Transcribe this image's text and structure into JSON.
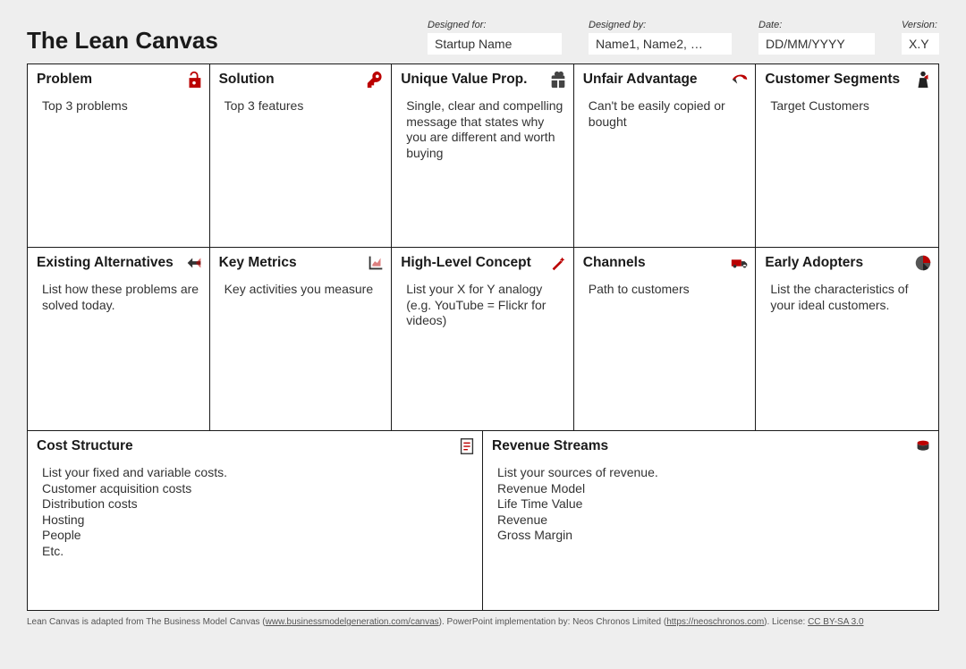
{
  "title": "The Lean Canvas",
  "meta": {
    "designed_for": {
      "label": "Designed for:",
      "value": "Startup Name"
    },
    "designed_by": {
      "label": "Designed by:",
      "value": "Name1, Name2, …"
    },
    "date": {
      "label": "Date:",
      "value": "DD/MM/YYYY"
    },
    "version": {
      "label": "Version:",
      "value": "X.Y"
    }
  },
  "blocks": {
    "problem": {
      "title": "Problem",
      "body": "Top 3 problems"
    },
    "solution": {
      "title": "Solution",
      "body": "Top 3 features"
    },
    "uvp": {
      "title": "Unique Value Prop.",
      "body": "Single, clear and compelling message that states why you are different and worth buying"
    },
    "unfair": {
      "title": "Unfair Advantage",
      "body": "Can't be easily copied or bought"
    },
    "segments": {
      "title": "Customer Segments",
      "body": "Target Customers"
    },
    "existing": {
      "title": "Existing Alternatives",
      "body": "List how these problems are solved today."
    },
    "metrics": {
      "title": "Key Metrics",
      "body": "Key activities you measure"
    },
    "concept": {
      "title": "High-Level Concept",
      "body": "List your X for Y analogy (e.g. YouTube = Flickr for videos)"
    },
    "channels": {
      "title": "Channels",
      "body": "Path to customers"
    },
    "early": {
      "title": "Early Adopters",
      "body": "List the characteristics of your ideal customers."
    },
    "cost": {
      "title": "Cost Structure",
      "lines": [
        "List your fixed and variable costs.",
        "Customer acquisition costs",
        "Distribution costs",
        "Hosting",
        "People",
        "Etc."
      ]
    },
    "revenue": {
      "title": "Revenue Streams",
      "lines": [
        "List your sources of revenue.",
        "Revenue Model",
        "Life Time Value",
        "Revenue",
        "Gross Margin"
      ]
    }
  },
  "footer": {
    "pre": "Lean Canvas is adapted from The Business Model Canvas (",
    "link1": "www.businessmodelgeneration.com/canvas",
    "mid1": "). PowerPoint implementation by: Neos Chronos Limited (",
    "link2": "https://neoschronos.com",
    "mid2": "). License: ",
    "link3": "CC BY-SA 3.0"
  }
}
